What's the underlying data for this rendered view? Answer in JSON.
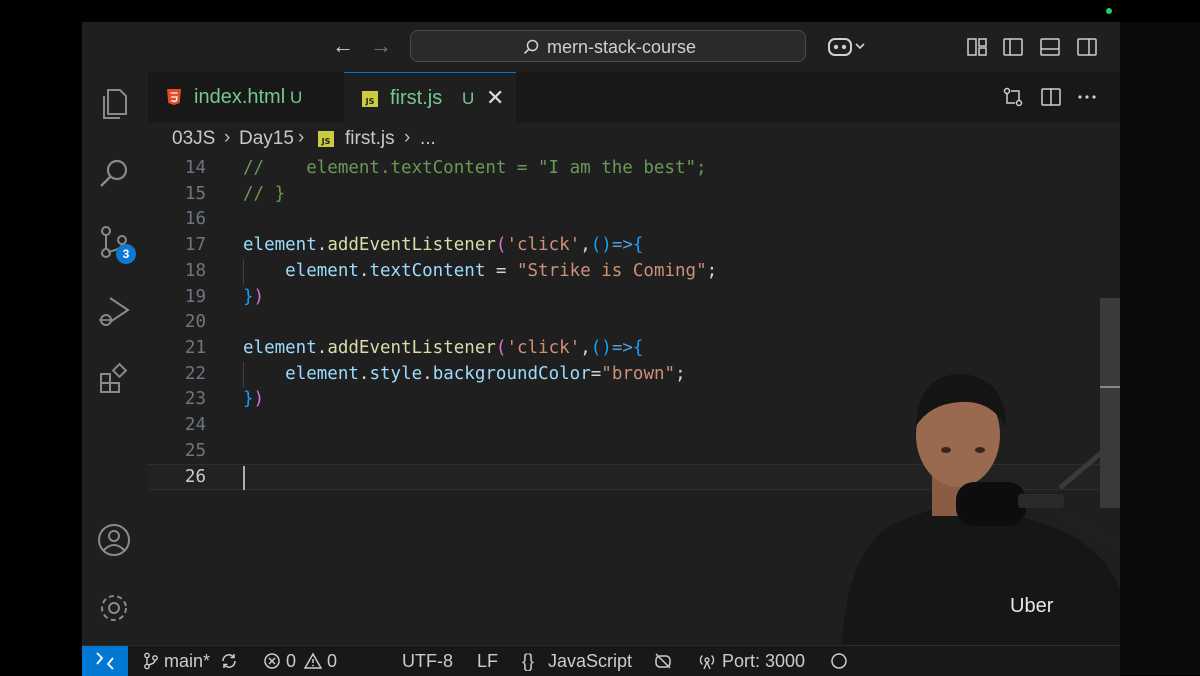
{
  "window": {
    "search_text": "mern-stack-course"
  },
  "activity_bar": {
    "source_control_badge": "3"
  },
  "tabs": [
    {
      "label": "index.html",
      "status": "U",
      "icon": "html5-icon"
    },
    {
      "label": "first.js",
      "status": "U",
      "icon": "js-icon",
      "active": true
    }
  ],
  "breadcrumbs": {
    "folder1": "03JS",
    "folder2": "Day15",
    "file": "first.js",
    "more": "..."
  },
  "editor": {
    "lines": [
      {
        "num": "14",
        "parts": [
          {
            "t": "//    element.textContent = \"I am the best\";",
            "c": "comment"
          }
        ]
      },
      {
        "num": "15",
        "parts": [
          {
            "t": "// }",
            "c": "comment"
          }
        ]
      },
      {
        "num": "16",
        "parts": []
      },
      {
        "num": "17",
        "parts": [
          {
            "t": "element",
            "c": "var"
          },
          {
            "t": ".",
            "c": "plain"
          },
          {
            "t": "addEventListener",
            "c": "fn"
          },
          {
            "t": "(",
            "c": "brace"
          },
          {
            "t": "'click'",
            "c": "str"
          },
          {
            "t": ",",
            "c": "plain"
          },
          {
            "t": "()",
            "c": "paren"
          },
          {
            "t": "=>",
            "c": "arrow"
          },
          {
            "t": "{",
            "c": "paren"
          }
        ]
      },
      {
        "num": "18",
        "parts": [
          {
            "t": "    ",
            "c": "plain"
          },
          {
            "t": "element",
            "c": "var"
          },
          {
            "t": ".",
            "c": "plain"
          },
          {
            "t": "textContent",
            "c": "var"
          },
          {
            "t": " = ",
            "c": "plain"
          },
          {
            "t": "\"Strike is Coming\"",
            "c": "str"
          },
          {
            "t": ";",
            "c": "plain"
          }
        ]
      },
      {
        "num": "19",
        "parts": [
          {
            "t": "}",
            "c": "paren"
          },
          {
            "t": ")",
            "c": "brace"
          }
        ]
      },
      {
        "num": "20",
        "parts": []
      },
      {
        "num": "21",
        "parts": [
          {
            "t": "element",
            "c": "var"
          },
          {
            "t": ".",
            "c": "plain"
          },
          {
            "t": "addEventListener",
            "c": "fn"
          },
          {
            "t": "(",
            "c": "brace"
          },
          {
            "t": "'click'",
            "c": "str"
          },
          {
            "t": ",",
            "c": "plain"
          },
          {
            "t": "()",
            "c": "paren"
          },
          {
            "t": "=>",
            "c": "arrow"
          },
          {
            "t": "{",
            "c": "paren"
          }
        ]
      },
      {
        "num": "22",
        "parts": [
          {
            "t": "    ",
            "c": "plain"
          },
          {
            "t": "element",
            "c": "var"
          },
          {
            "t": ".",
            "c": "plain"
          },
          {
            "t": "style",
            "c": "var"
          },
          {
            "t": ".",
            "c": "plain"
          },
          {
            "t": "backgroundColor",
            "c": "var"
          },
          {
            "t": "=",
            "c": "plain"
          },
          {
            "t": "\"brown\"",
            "c": "str"
          },
          {
            "t": ";",
            "c": "plain"
          }
        ]
      },
      {
        "num": "23",
        "parts": [
          {
            "t": "}",
            "c": "paren"
          },
          {
            "t": ")",
            "c": "brace"
          }
        ]
      },
      {
        "num": "24",
        "parts": []
      },
      {
        "num": "25",
        "parts": []
      },
      {
        "num": "26",
        "parts": [],
        "current": true
      }
    ]
  },
  "status_bar": {
    "branch": "main*",
    "errors": "0",
    "warnings": "0",
    "encoding": "UTF-8",
    "eol": "LF",
    "language": "JavaScript",
    "port": "Port: 3000"
  },
  "webcam": {
    "shirt_logo": "Uber"
  },
  "colors": {
    "accent": "#0078d4",
    "badge": "#0f78d4",
    "untracked": "#73c991",
    "comment": "#6a9955",
    "string": "#ce9178",
    "variable": "#9cdcfe",
    "function": "#dcdcaa"
  }
}
